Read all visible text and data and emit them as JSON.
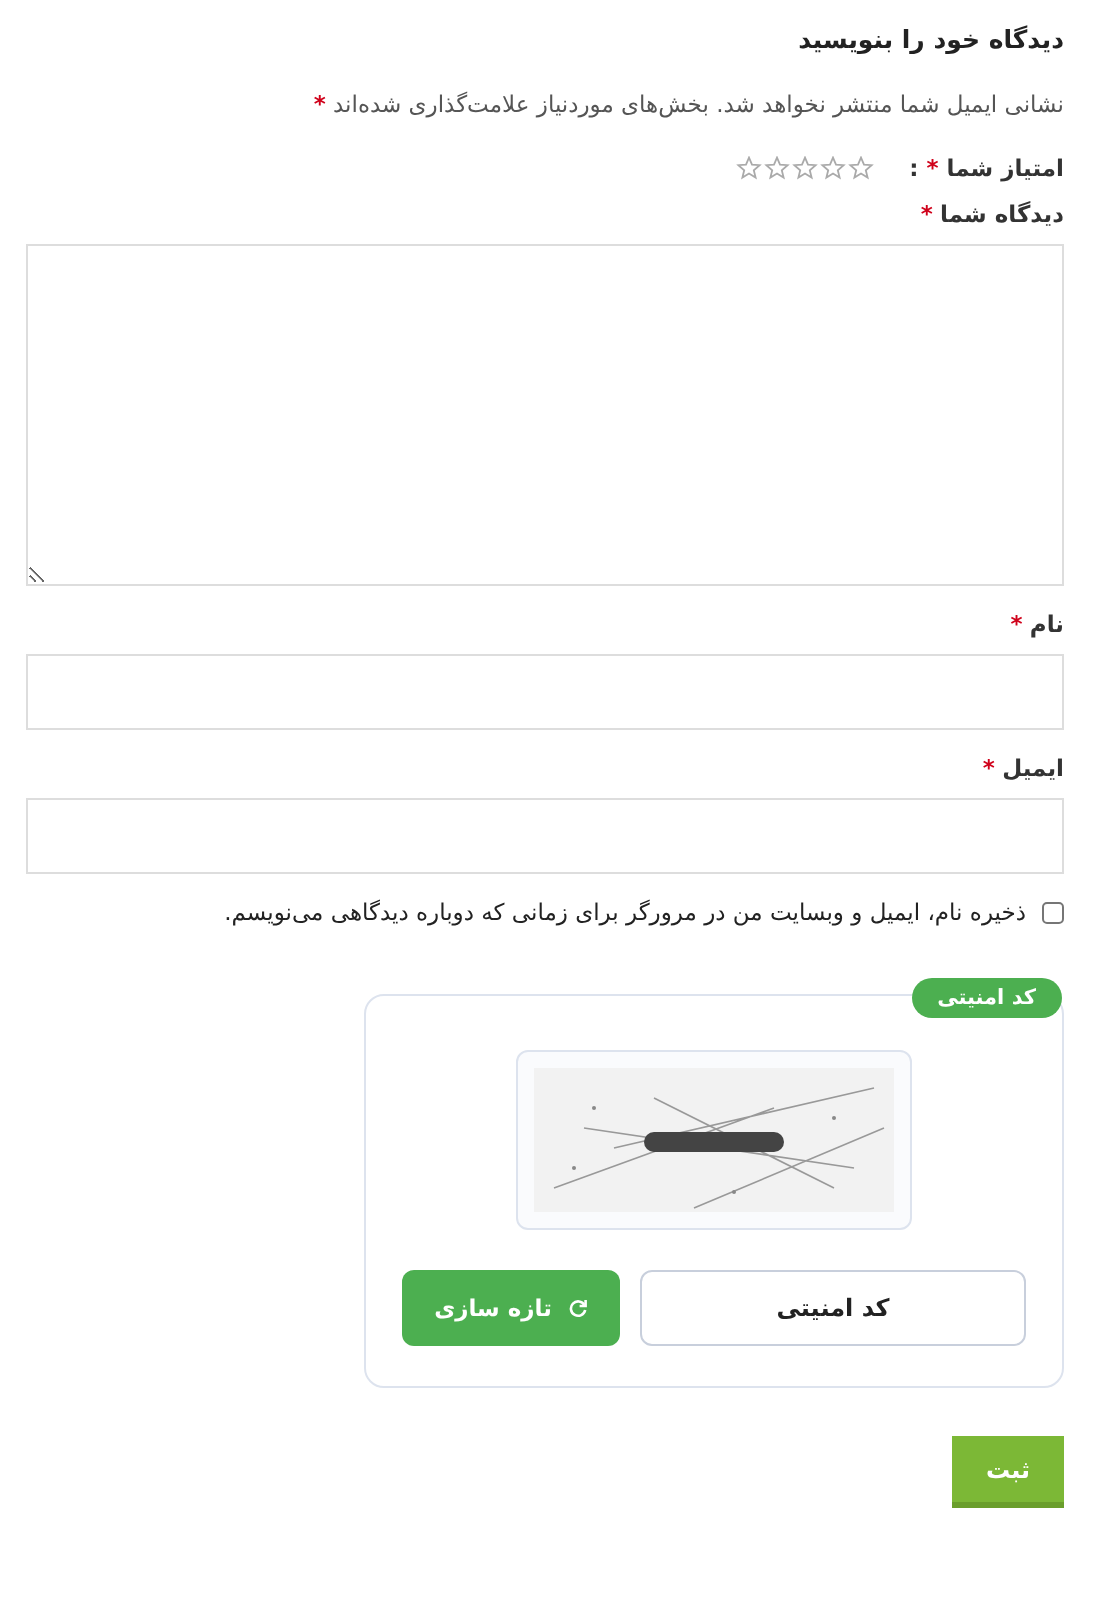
{
  "heading": "دیدگاه خود را بنویسید",
  "notice": {
    "text": "نشانی ایمیل شما منتشر نخواهد شد. بخش‌های موردنیاز علامت‌گذاری شده‌اند",
    "marker": "*"
  },
  "rating": {
    "label": "امتیاز شما",
    "marker": "*",
    "colon": ":",
    "stars": 0
  },
  "fields": [
    {
      "kind": "textarea",
      "label": "دیدگاه شما",
      "marker": "*"
    },
    {
      "kind": "input",
      "label": "نام",
      "marker": "*"
    },
    {
      "kind": "input",
      "label": "ایمیل",
      "marker": "*"
    }
  ],
  "remember": {
    "label": "ذخیره نام، ایمیل و وبسایت من در مرورگر برای زمانی که دوباره دیدگاهی می‌نویسم.",
    "checked": false
  },
  "captcha": {
    "badge": "کد امنیتی",
    "placeholder": "کد امنیتی",
    "refresh": "تازه سازی"
  },
  "submit": "ثبت"
}
